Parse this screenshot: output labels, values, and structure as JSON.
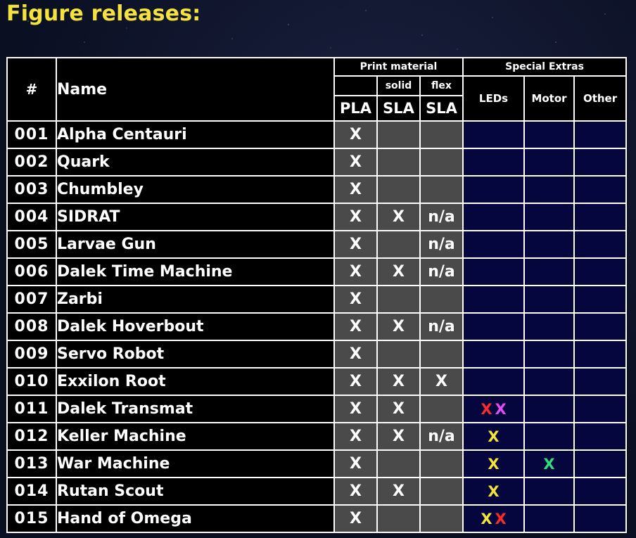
{
  "page": {
    "title": "Figure releases:"
  },
  "colors": {
    "title": "#f5e23c",
    "name_text": "#8ff0ec",
    "material_bg": "#4a4a4a",
    "extras_bg": "#06063e",
    "led_red": "#ff2a2a",
    "led_magenta": "#e04cf0",
    "led_yellow": "#f5e23c",
    "motor_green": "#2ee07a"
  },
  "table": {
    "headers": {
      "num": "#",
      "name": "Name",
      "print_material": "Print material",
      "special_extras": "Special Extras",
      "solid": "solid",
      "flex": "flex",
      "pla": "PLA",
      "sla_solid": "SLA",
      "sla_flex": "SLA",
      "leds": "LEDs",
      "motor": "Motor",
      "other": "Other"
    },
    "rows": [
      {
        "num": "001",
        "name": "Alpha Centauri",
        "pla": "X",
        "sla_solid": "",
        "sla_flex": "",
        "leds": [],
        "motor": [],
        "other": []
      },
      {
        "num": "002",
        "name": "Quark",
        "pla": "X",
        "sla_solid": "",
        "sla_flex": "",
        "leds": [],
        "motor": [],
        "other": []
      },
      {
        "num": "003",
        "name": "Chumbley",
        "pla": "X",
        "sla_solid": "",
        "sla_flex": "",
        "leds": [],
        "motor": [],
        "other": []
      },
      {
        "num": "004",
        "name": "SIDRAT",
        "pla": "X",
        "sla_solid": "X",
        "sla_flex": "n/a",
        "leds": [],
        "motor": [],
        "other": []
      },
      {
        "num": "005",
        "name": "Larvae Gun",
        "pla": "X",
        "sla_solid": "",
        "sla_flex": "n/a",
        "leds": [],
        "motor": [],
        "other": []
      },
      {
        "num": "006",
        "name": "Dalek Time Machine",
        "pla": "X",
        "sla_solid": "X",
        "sla_flex": "n/a",
        "leds": [],
        "motor": [],
        "other": []
      },
      {
        "num": "007",
        "name": "Zarbi",
        "pla": "X",
        "sla_solid": "",
        "sla_flex": "",
        "leds": [],
        "motor": [],
        "other": []
      },
      {
        "num": "008",
        "name": "Dalek Hoverbout",
        "pla": "X",
        "sla_solid": "X",
        "sla_flex": "n/a",
        "leds": [],
        "motor": [],
        "other": []
      },
      {
        "num": "009",
        "name": "Servo Robot",
        "pla": "X",
        "sla_solid": "",
        "sla_flex": "",
        "leds": [],
        "motor": [],
        "other": []
      },
      {
        "num": "010",
        "name": "Exxilon Root",
        "pla": "X",
        "sla_solid": "X",
        "sla_flex": "X",
        "leds": [],
        "motor": [],
        "other": []
      },
      {
        "num": "011",
        "name": "Dalek Transmat",
        "pla": "X",
        "sla_solid": "X",
        "sla_flex": "",
        "leds": [
          {
            "text": "X",
            "color": "#ff2a2a"
          },
          {
            "text": "X",
            "color": "#e04cf0"
          }
        ],
        "motor": [],
        "other": []
      },
      {
        "num": "012",
        "name": "Keller Machine",
        "pla": "X",
        "sla_solid": "X",
        "sla_flex": "n/a",
        "leds": [
          {
            "text": "X",
            "color": "#f5e23c"
          }
        ],
        "motor": [],
        "other": []
      },
      {
        "num": "013",
        "name": "War Machine",
        "pla": "X",
        "sla_solid": "",
        "sla_flex": "",
        "leds": [
          {
            "text": "X",
            "color": "#f5e23c"
          }
        ],
        "motor": [
          {
            "text": "X",
            "color": "#2ee07a"
          }
        ],
        "other": []
      },
      {
        "num": "014",
        "name": "Rutan Scout",
        "pla": "X",
        "sla_solid": "X",
        "sla_flex": "",
        "leds": [
          {
            "text": "X",
            "color": "#f5e23c"
          }
        ],
        "motor": [],
        "other": []
      },
      {
        "num": "015",
        "name": "Hand of Omega",
        "pla": "X",
        "sla_solid": "",
        "sla_flex": "",
        "leds": [
          {
            "text": "X",
            "color": "#f5e23c"
          },
          {
            "text": "X",
            "color": "#ff2a2a"
          }
        ],
        "motor": [],
        "other": []
      }
    ]
  }
}
